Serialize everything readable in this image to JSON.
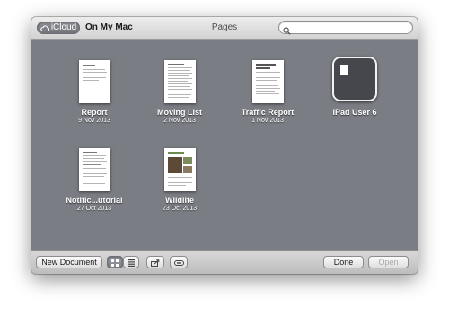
{
  "window": {
    "title": "Pages",
    "location_tabs": [
      {
        "label": "iCloud",
        "selected": true,
        "icon": "cloud-icon"
      },
      {
        "label": "On My Mac",
        "selected": false
      }
    ],
    "search": {
      "placeholder": "",
      "value": ""
    }
  },
  "documents": [
    {
      "name": "Report",
      "date": "9 Nov 2013",
      "kind": "document"
    },
    {
      "name": "Moving List",
      "date": "2 Nov 2013",
      "kind": "document"
    },
    {
      "name": "Traffic Report",
      "date": "1 Nov 2013",
      "kind": "document"
    },
    {
      "name": "iPad User 6",
      "date": "",
      "kind": "folder"
    },
    {
      "name": "Notific...utorial",
      "date": "27 Oct 2013",
      "kind": "document"
    },
    {
      "name": "Wildlife",
      "date": "23 Oct 2013",
      "kind": "document"
    }
  ],
  "toolbar": {
    "new_document_label": "New Document",
    "view_mode": "icons",
    "icons": {
      "icon_view": "grid-icon",
      "list_view": "list-icon",
      "share": "share-icon",
      "tag": "tag-icon"
    },
    "done_label": "Done",
    "open_label": "Open",
    "open_enabled": false
  },
  "colors": {
    "browser_background": "#7a7d83",
    "folder_fill": "#46474c",
    "selected_segment": "#7f8288"
  }
}
